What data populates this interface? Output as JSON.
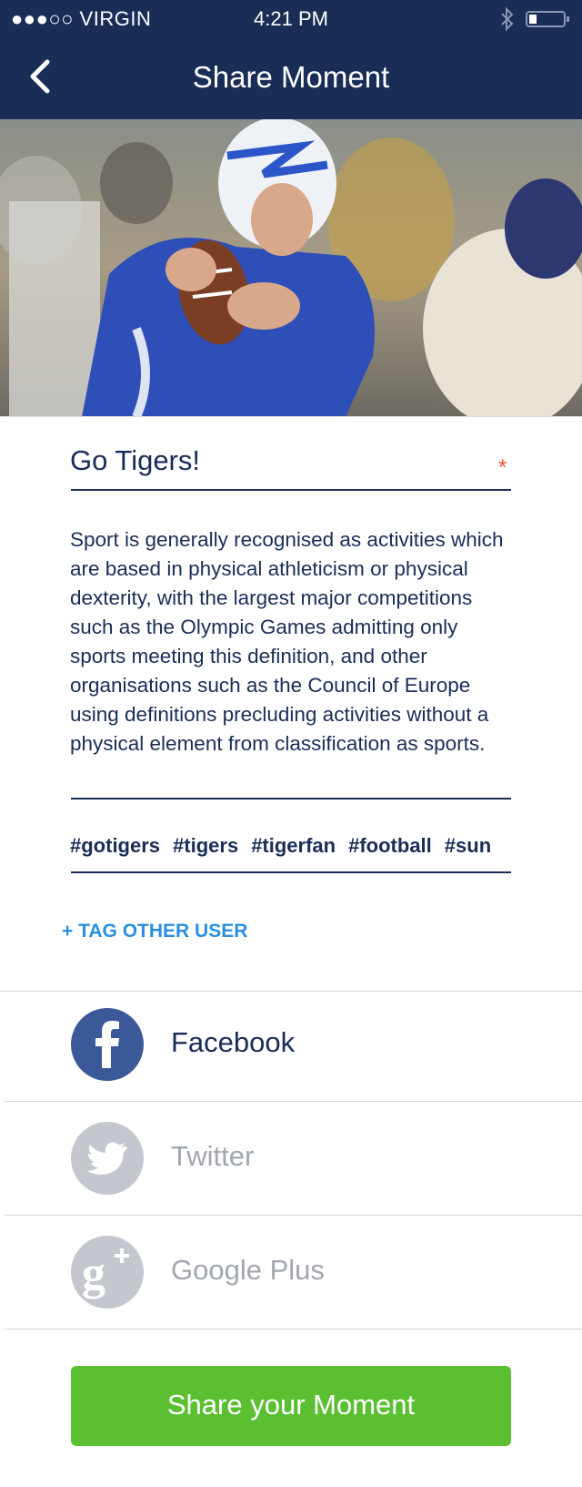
{
  "status_bar": {
    "carrier": "●●●○○ VIRGIN",
    "time": "4:21 PM",
    "bluetooth": "bluetooth-icon",
    "battery": "battery-icon"
  },
  "header": {
    "title": "Share Moment",
    "back_icon": "chevron-left-icon"
  },
  "hero": {
    "image": "football-quarterback-photo"
  },
  "form": {
    "title_value": "Go Tigers!",
    "required_mark": "*",
    "description": "Sport is generally recognised as activities which are based in physical athleticism or physical dexterity, with the largest major competitions such as the Olympic Games admitting only sports meeting this definition, and other organisations such as the Council of Europe using definitions precluding activities without a physical element from classification as sports.",
    "tags": [
      "#gotigers",
      "#tigers",
      "#tigerfan",
      "#football",
      "#sun"
    ],
    "tag_user_label": "+ TAG OTHER USER"
  },
  "share": {
    "options": [
      {
        "label": "Facebook",
        "icon": "facebook-icon",
        "active": true
      },
      {
        "label": "Twitter",
        "icon": "twitter-icon",
        "active": false
      },
      {
        "label": "Google Plus",
        "icon": "google-plus-icon",
        "active": false
      }
    ],
    "submit_label": "Share your Moment"
  },
  "colors": {
    "navy": "#1a2d57",
    "accent_blue": "#2a8fe0",
    "facebook_blue": "#3b5998",
    "inactive_gray": "#c4c7ce",
    "inactive_text": "#a2a6b0",
    "share_green": "#5bbf32",
    "required_red": "#e8542a"
  }
}
